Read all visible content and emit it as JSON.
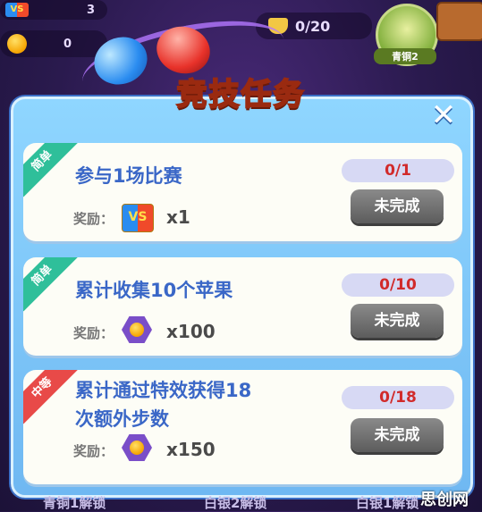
{
  "hud": {
    "vs_label": "VS",
    "vs_count": "3",
    "apple_count": "0",
    "trophy_progress": "0/20",
    "rank_label": "青铜2"
  },
  "dialog": {
    "title": "竞技任务",
    "close_symbol": "✕",
    "reward_label": "奖励：",
    "tasks": [
      {
        "difficulty": "简单",
        "title_line1": "参与1场比赛",
        "title_line2": "",
        "reward_icon": "vs-ticket-icon",
        "reward_qty": "x1",
        "progress": "0/1",
        "status": "未完成"
      },
      {
        "difficulty": "简单",
        "title_line1": "累计收集10个苹果",
        "title_line2": "",
        "reward_icon": "apple-hexagon-icon",
        "reward_qty": "x100",
        "progress": "0/10",
        "status": "未完成"
      },
      {
        "difficulty": "中等",
        "title_line1": "累计通过特效获得18",
        "title_line2": "次额外步数",
        "reward_icon": "apple-hexagon-icon",
        "reward_qty": "x150",
        "progress": "0/18",
        "status": "未完成"
      }
    ]
  },
  "bottom": {
    "unlock_1": "青铜1解锁",
    "unlock_2": "白银2解锁",
    "unlock_3": "白银1解锁"
  },
  "watermark": "思创网",
  "colors": {
    "panel": "#8fd6ff",
    "title_text": "#ffe04a",
    "task_text": "#3a67c7",
    "easy_ribbon": "#2fbf9a",
    "medium_ribbon": "#e84a48",
    "progress_text": "#d12a2a",
    "status_button": "#6e6e6e"
  }
}
